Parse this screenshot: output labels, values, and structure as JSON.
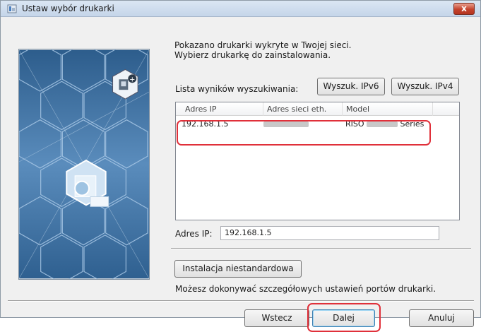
{
  "window": {
    "title": "Ustaw wybór drukarki",
    "close_label": "x"
  },
  "intro": {
    "line1": "Pokazano drukarki wykryte w Twojej sieci.",
    "line2": "Wybierz drukarkę do zainstalowania."
  },
  "search": {
    "label": "Lista wyników wyszukiwania:",
    "ipv6_button": "Wyszuk. IPv6",
    "ipv4_button": "Wyszuk. IPv4"
  },
  "list": {
    "columns": [
      "Adres IP",
      "Adres sieci eth.",
      "Model"
    ],
    "rows": [
      {
        "ip": "192.168.1.5",
        "model_prefix": "RISO",
        "model_suffix": "Series"
      }
    ]
  },
  "ip_field": {
    "label": "Adres IP:",
    "value": "192.168.1.5"
  },
  "custom": {
    "button": "Instalacja niestandardowa",
    "description": "Możesz dokonywać szczegółowych ustawień portów drukarki."
  },
  "footer": {
    "back": "Wstecz",
    "next": "Dalej",
    "cancel": "Anuluj"
  },
  "colors": {
    "highlight": "#e0303a",
    "art_bg": "#3a6c9a"
  }
}
